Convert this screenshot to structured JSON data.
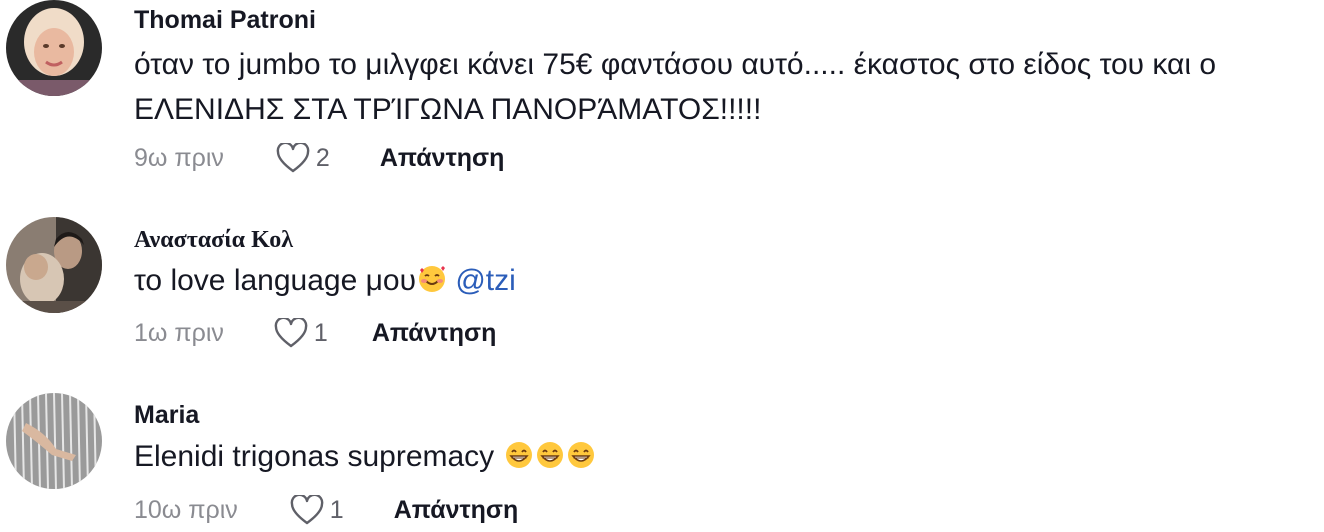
{
  "comments": [
    {
      "username": "Thomai Patroni",
      "text": "όταν το jumbo το μιλγφει κάνει 75€ φαντάσου αυτό..... έκαστος στο είδος του και ο ΕΛΕΝΙΔΗΣ ΣΤΑ ΤΡΊΓΩΝΑ ΠΑΝΟΡΆΜΑΤΟΣ!!!!!",
      "time": "9ω πριν",
      "likes": "2",
      "reply_label": "Απάντηση"
    },
    {
      "username": "𝐀𝐧𝐚𝐬𝐭𝐚𝐬𝐢𝐚 𝐊𝐨𝐥",
      "username_display": "Αναστασία Κολ",
      "text": "το love language μου",
      "emoji": "smiling-face-with-hearts",
      "mention": "@tzi",
      "time": "1ω πριν",
      "likes": "1",
      "reply_label": "Απάντηση"
    },
    {
      "username": "Maria",
      "text": "Elenidi trigonas supremacy",
      "emoji": "grinning-face-with-smiling-eyes",
      "time": "10ω πριν",
      "likes": "1",
      "reply_label": "Απάντηση"
    }
  ]
}
